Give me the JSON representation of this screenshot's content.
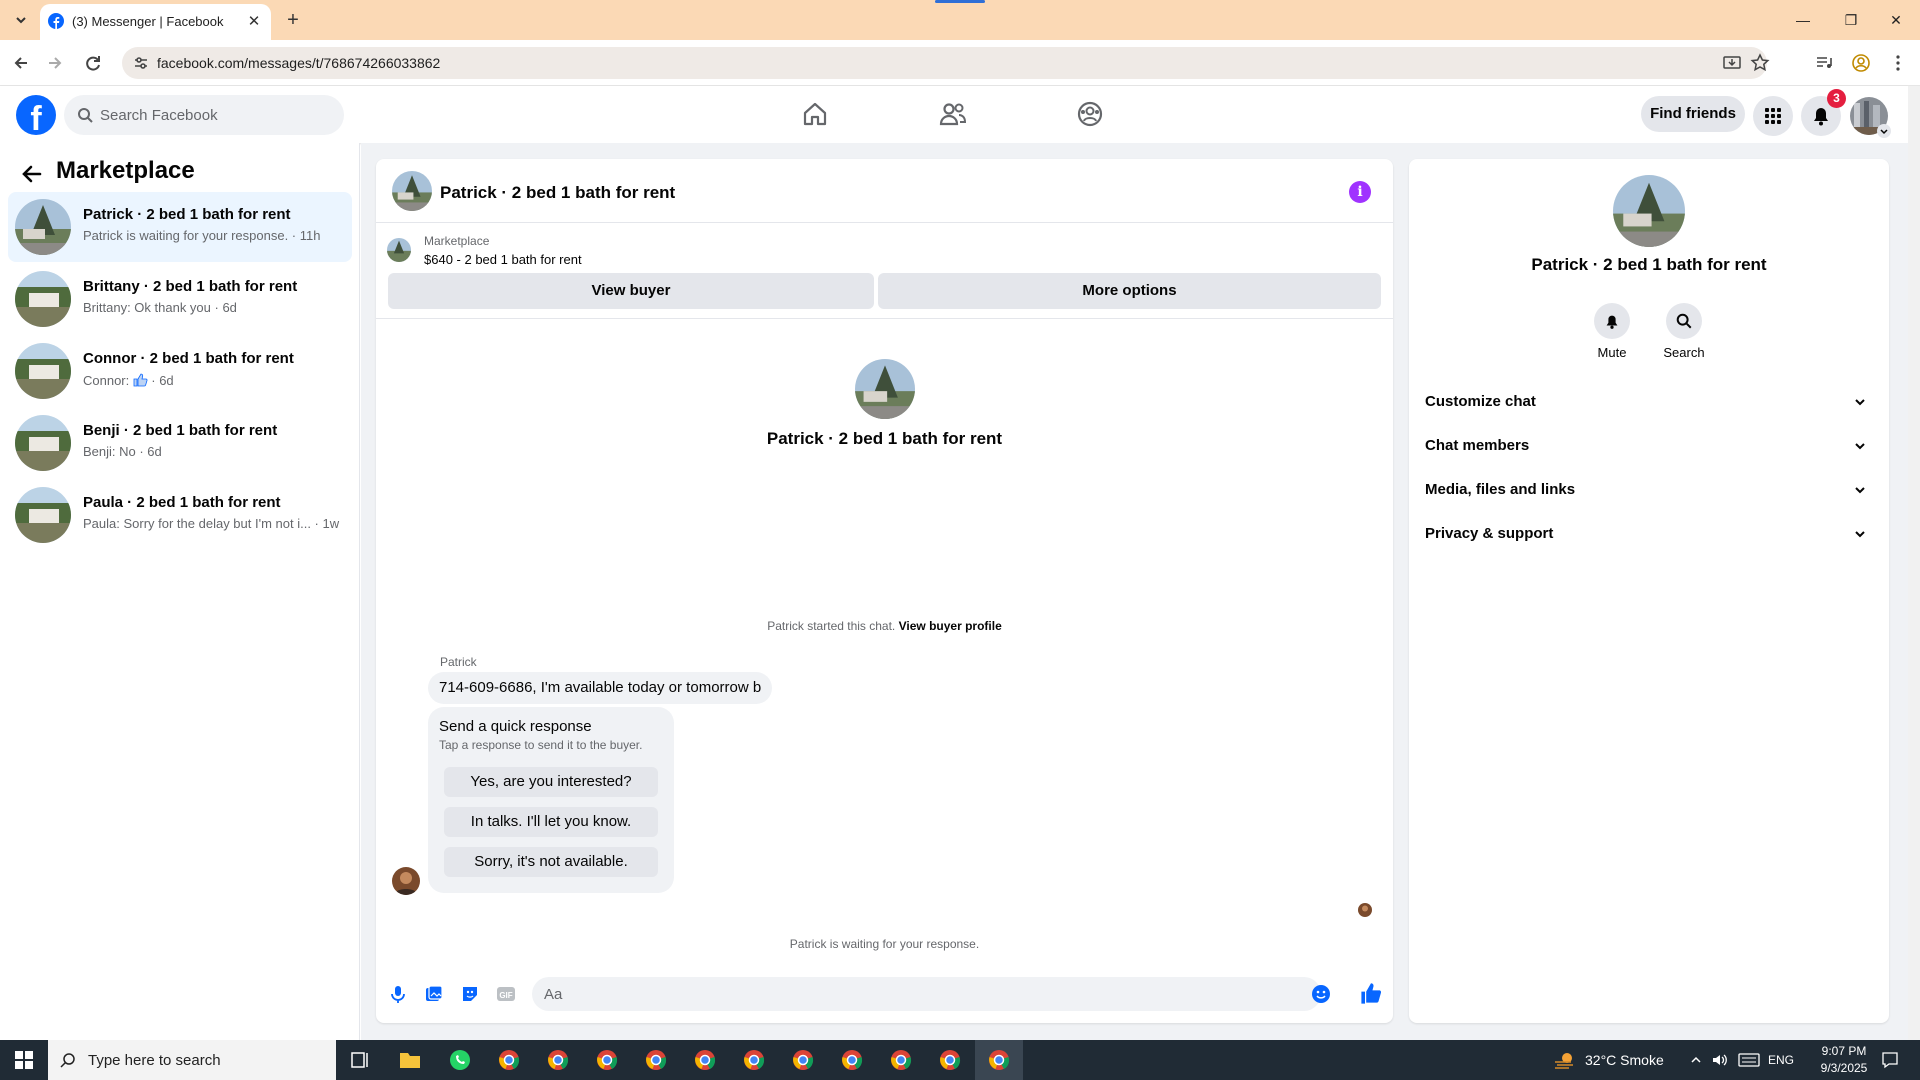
{
  "browser": {
    "tab_title": "(3) Messenger | Facebook",
    "url": "facebook.com/messages/t/768674266033862"
  },
  "header": {
    "search_placeholder": "Search Facebook",
    "find_friends": "Find friends",
    "notification_count": "3"
  },
  "sidebar": {
    "title": "Marketplace",
    "conversations": [
      {
        "name": "Patrick · 2 bed 1 bath for rent",
        "preview": "Patrick is waiting for your response. · 11h",
        "active": true
      },
      {
        "name": "Brittany · 2 bed 1 bath for rent",
        "preview": "Brittany: Ok thank you · 6d"
      },
      {
        "name": "Connor · 2 bed 1 bath for rent",
        "preview_prefix": "Connor:",
        "preview_suffix": "· 6d"
      },
      {
        "name": "Benji · 2 bed 1 bath for rent",
        "preview": "Benji: No · 6d"
      },
      {
        "name": "Paula · 2 bed 1 bath for rent",
        "preview": "Paula: Sorry for the delay but I'm not i... · 1w"
      }
    ]
  },
  "chat": {
    "title": "Patrick · 2 bed 1 bath for rent",
    "listing_label": "Marketplace",
    "listing_price": "$640 - 2 bed 1 bath for rent",
    "view_buyer": "View buyer",
    "more_options": "More options",
    "convo_name": "Patrick · 2 bed 1 bath for rent",
    "started_text": "Patrick started this chat.",
    "view_buyer_profile": "View buyer profile",
    "sender": "Patrick",
    "message": "714-609-6686, I'm available today or tomorrow b",
    "quick_title": "Send a quick response",
    "quick_sub": "Tap a response to send it to the buyer.",
    "quick_responses": [
      "Yes, are you interested?",
      "In talks. I'll let you know.",
      "Sorry, it's not available."
    ],
    "waiting": "Patrick is waiting for your response.",
    "input_placeholder": "Aa"
  },
  "info_panel": {
    "name": "Patrick · 2 bed 1 bath for rent",
    "mute": "Mute",
    "search": "Search",
    "sections": [
      "Customize chat",
      "Chat members",
      "Media, files and links",
      "Privacy & support"
    ]
  },
  "taskbar": {
    "search_placeholder": "Type here to search",
    "weather": "32°C  Smoke",
    "lang": "ENG",
    "time": "9:07 PM",
    "date": "9/3/2025"
  },
  "colors": {
    "fb_blue": "#0866ff",
    "info_purple": "#a033ff",
    "tab_bar": "#fbd9b5"
  }
}
